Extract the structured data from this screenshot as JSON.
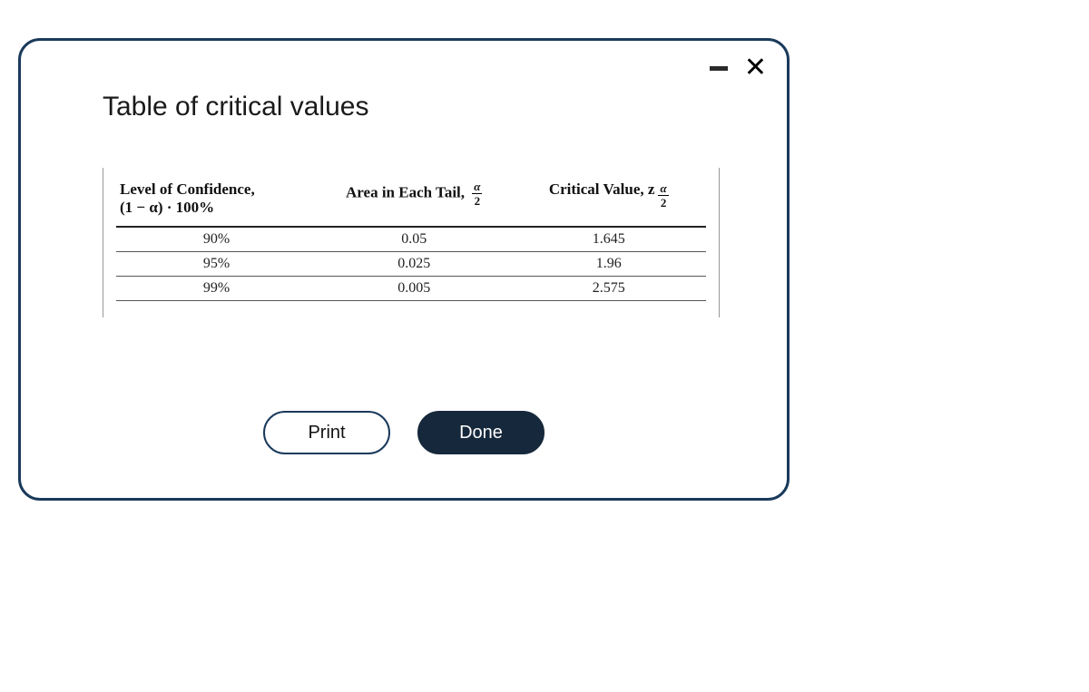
{
  "title": "Table of critical values",
  "table": {
    "headers": {
      "col1_line1": "Level of Confidence,",
      "col1_line2": "(1 − α) · 100%",
      "col2_prefix": "Area in Each Tail,",
      "col2_frac_num": "α",
      "col2_frac_den": "2",
      "col3_prefix": "Critical Value, z",
      "col3_sub_num": "α",
      "col3_sub_den": "2"
    },
    "rows": [
      {
        "confidence": "90%",
        "tail": "0.05",
        "critical": "1.645"
      },
      {
        "confidence": "95%",
        "tail": "0.025",
        "critical": "1.96"
      },
      {
        "confidence": "99%",
        "tail": "0.005",
        "critical": "2.575"
      }
    ]
  },
  "buttons": {
    "print": "Print",
    "done": "Done"
  },
  "chart_data": {
    "type": "table",
    "columns": [
      "Level of Confidence (1−α)·100%",
      "Area in Each Tail α/2",
      "Critical Value z_{α/2}"
    ],
    "rows": [
      [
        "90%",
        0.05,
        1.645
      ],
      [
        "95%",
        0.025,
        1.96
      ],
      [
        "99%",
        0.005,
        2.575
      ]
    ]
  }
}
